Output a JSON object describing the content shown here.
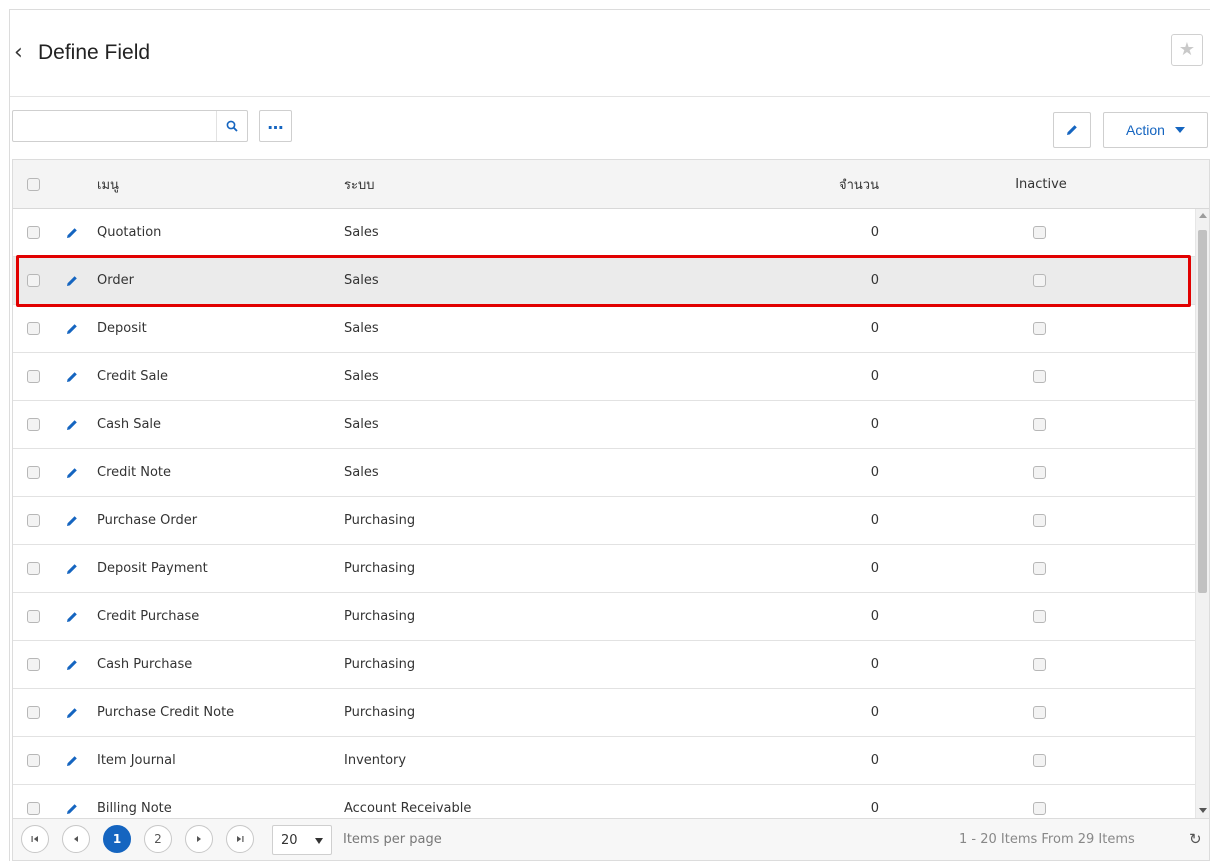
{
  "page": {
    "title": "Define Field"
  },
  "search": {
    "value": "",
    "placeholder": ""
  },
  "toolbar": {
    "action_label": "Action"
  },
  "table": {
    "headers": {
      "menu": "เมนู",
      "system": "ระบบ",
      "count": "จำนวน",
      "inactive": "Inactive"
    },
    "rows": [
      {
        "menu": "Quotation",
        "system": "Sales",
        "count": "0",
        "inactive": false,
        "selected": false
      },
      {
        "menu": "Order",
        "system": "Sales",
        "count": "0",
        "inactive": false,
        "selected": true
      },
      {
        "menu": "Deposit",
        "system": "Sales",
        "count": "0",
        "inactive": false,
        "selected": false
      },
      {
        "menu": "Credit Sale",
        "system": "Sales",
        "count": "0",
        "inactive": false,
        "selected": false
      },
      {
        "menu": "Cash Sale",
        "system": "Sales",
        "count": "0",
        "inactive": false,
        "selected": false
      },
      {
        "menu": "Credit Note",
        "system": "Sales",
        "count": "0",
        "inactive": false,
        "selected": false
      },
      {
        "menu": "Purchase Order",
        "system": "Purchasing",
        "count": "0",
        "inactive": false,
        "selected": false
      },
      {
        "menu": "Deposit Payment",
        "system": "Purchasing",
        "count": "0",
        "inactive": false,
        "selected": false
      },
      {
        "menu": "Credit Purchase",
        "system": "Purchasing",
        "count": "0",
        "inactive": false,
        "selected": false
      },
      {
        "menu": "Cash Purchase",
        "system": "Purchasing",
        "count": "0",
        "inactive": false,
        "selected": false
      },
      {
        "menu": "Purchase Credit Note",
        "system": "Purchasing",
        "count": "0",
        "inactive": false,
        "selected": false
      },
      {
        "menu": "Item Journal",
        "system": "Inventory",
        "count": "0",
        "inactive": false,
        "selected": false
      },
      {
        "menu": "Billing Note",
        "system": "Account Receivable",
        "count": "0",
        "inactive": false,
        "selected": false
      }
    ]
  },
  "pager": {
    "pages": [
      "1",
      "2"
    ],
    "current_page": "1",
    "page_size": "20",
    "items_per_page_label": "Items per page",
    "info": "1 - 20 Items From 29 Items"
  },
  "icons": {
    "back": "chevron-left-icon",
    "favorite": "star-icon",
    "search": "search-icon",
    "more": "ellipsis-icon",
    "edit": "pencil-icon",
    "refresh": "refresh-icon"
  },
  "colors": {
    "accent": "#1565c0",
    "highlight": "#e10000",
    "selected_row": "#ebebeb"
  }
}
